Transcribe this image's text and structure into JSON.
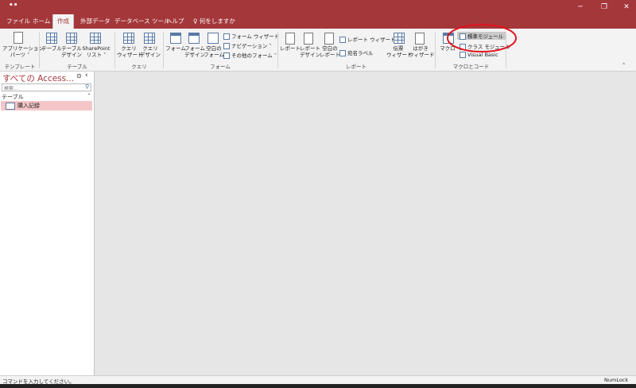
{
  "titlebar": {
    "app_dots": "••"
  },
  "tabs": [
    "ファイル",
    "ホーム",
    "作成",
    "外部データ",
    "データベース ツール",
    "ヘルプ",
    "何をしますか"
  ],
  "ribbon": {
    "template": {
      "btn": "アプリケーション\nパーツ ˅",
      "label": "テンプレート"
    },
    "table": {
      "btn_table": "テーブル",
      "btn_design": "テーブル\nデザイン",
      "btn_sharepoint": "SharePoint\nリスト ˅",
      "label": "テーブル"
    },
    "query": {
      "btn_wizard": "クエリ\nウィザード",
      "btn_design": "クエリ\nデザイン",
      "label": "クエリ"
    },
    "form": {
      "btn_form": "フォーム",
      "btn_design": "フォーム\nデザイン",
      "btn_blank": "空白の\nフォーム",
      "btn_wizard": "フォーム ウィザード",
      "btn_nav": "ナビゲーション ˅",
      "btn_more": "その他のフォーム ˅",
      "label": "フォーム"
    },
    "report": {
      "btn_report": "レポート",
      "btn_design": "レポート\nデザイン",
      "btn_blank": "空白の\nレポート",
      "btn_wizard": "レポート ウィザード",
      "btn_label": "宛名ラベル",
      "btn_slip": "伝票\nウィザード",
      "btn_postcard": "はがき\nウィザード",
      "label": "レポート"
    },
    "macro": {
      "btn_macro": "マクロ",
      "btn_module": "標準モジュール",
      "btn_class": "クラス モジュール",
      "btn_vb": "Visual Basic",
      "label": "マクロとコード"
    }
  },
  "nav": {
    "title": "すべての Access...",
    "search_placeholder": "検索...",
    "group": "テーブル",
    "items": [
      "購入記録"
    ]
  },
  "status": {
    "left": "コマンドを入力してください。",
    "right": "NumLock"
  },
  "colors": {
    "accent": "#a4373a",
    "highlight_circle": "#e0141e",
    "selected_row": "#f5c6c8"
  }
}
